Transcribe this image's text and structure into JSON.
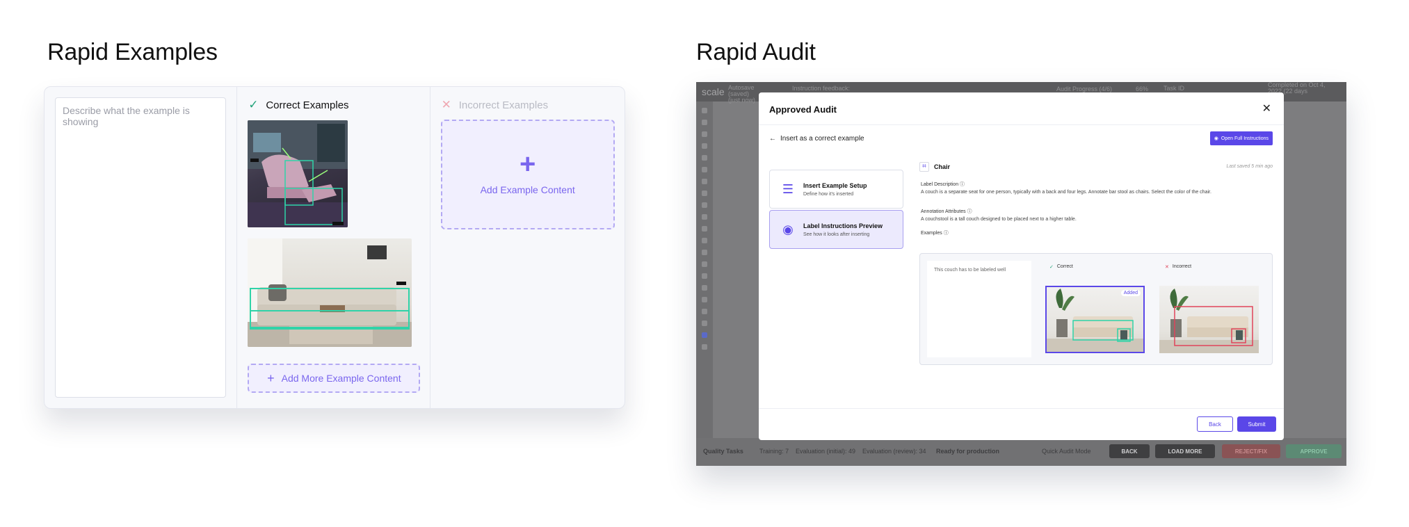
{
  "left": {
    "title": "Rapid Examples",
    "description_placeholder": "Describe what the example is showing",
    "correct_header": "Correct Examples",
    "incorrect_header": "Incorrect Examples",
    "add_example_label": "Add Example Content",
    "add_more_label": "Add More Example Content",
    "accent": "#7a66ee",
    "correct_color": "#22a37a",
    "incorrect_color": "#efa8b2"
  },
  "right": {
    "title": "Rapid Audit",
    "background": {
      "logo": "scale",
      "autosave": "Autosave (saved) (just now)",
      "instruction_feedback": "Instruction feedback:",
      "audit_progress": "Audit Progress (4/6)",
      "audit_percent": "66%",
      "task_id": "Task ID",
      "completed_on": "Completed on Oct 4, 2022 (22 days",
      "quality_tasks": "Quality Tasks",
      "training": "Training: 7",
      "evaluation_initial": "Evaluation (initial): 49",
      "evaluation_review": "Evaluation (review): 34",
      "ready": "Ready for production",
      "quick_audit": "Quick Audit Mode",
      "back_btn": "BACK",
      "load_more_btn": "LOAD MORE",
      "reject_btn": "REJECT/FIX",
      "approve_btn": "APPROVE"
    },
    "modal": {
      "title": "Approved Audit",
      "back_link": "Insert as a correct example",
      "open_full": "Open Full Instructions",
      "steps": [
        {
          "title": "Insert Example Setup",
          "subtitle": "Define how it's inserted"
        },
        {
          "title": "Label Instructions Preview",
          "subtitle": "See how it looks after inserting"
        }
      ],
      "label_name": "Chair",
      "last_saved": "Last saved 5 min ago",
      "label_description_title": "Label Description",
      "label_description": "A couch is a separate seat for one person, typically with a back and four legs. Annotate bar stool as chairs.  Select the color of the chair.",
      "annotation_attributes_title": "Annotation Attributes",
      "annotation_attributes": "A couchstool is a tall couch designed to be placed next to a higher table.",
      "examples_title": "Examples",
      "example_description": "This couch has to be labeled well",
      "correct_label": "Correct",
      "incorrect_label": "Incorrect",
      "added_badge": "Added",
      "back_button": "Back",
      "submit_button": "Submit",
      "accent": "#5a47e8"
    }
  }
}
